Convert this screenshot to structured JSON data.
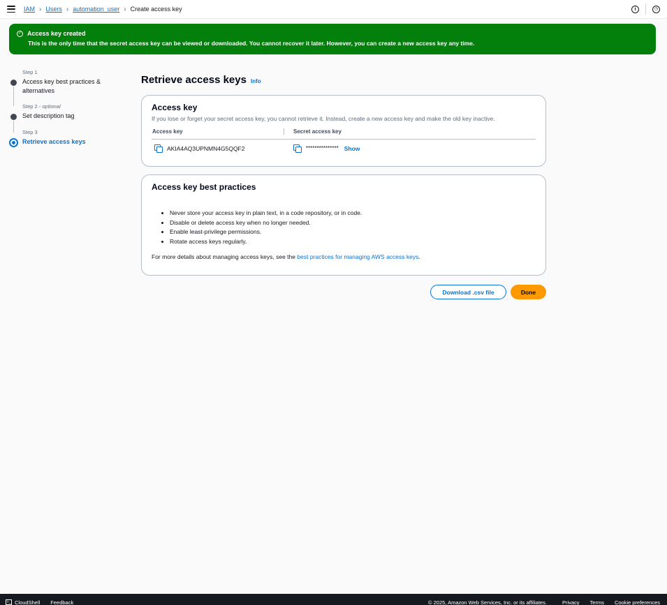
{
  "breadcrumb": {
    "items": [
      "IAM",
      "Users",
      "automation_user"
    ],
    "current": "Create access key"
  },
  "flash": {
    "title": "Access key created",
    "message": "This is the only time that the secret access key can be viewed or downloaded. You cannot recover it later. However, you can create a new access key any time.",
    "color": "#037f0c"
  },
  "steps": [
    {
      "num": "Step 1",
      "optional": "",
      "label": "Access key best practices & alternatives"
    },
    {
      "num": "Step 2",
      "optional": "optional",
      "label": "Set description tag"
    },
    {
      "num": "Step 3",
      "optional": "",
      "label": "Retrieve access keys"
    }
  ],
  "page": {
    "title": "Retrieve access keys",
    "info": "Info"
  },
  "access_key_card": {
    "title": "Access key",
    "description": "If you lose or forget your secret access key, you cannot retrieve it. Instead, create a new access key and make the old key inactive.",
    "col_access_key": "Access key",
    "col_secret_key": "Secret access key",
    "access_key_value": "AKIA4AQ3UPNMN4G5QQF2",
    "secret_masked": "***************",
    "show_label": "Show"
  },
  "best_practices": {
    "title": "Access key best practices",
    "items": [
      "Never store your access key in plain text, in a code repository, or in code.",
      "Disable or delete access key when no longer needed.",
      "Enable least-privilege permissions.",
      "Rotate access keys regularly."
    ],
    "more_prefix": "For more details about managing access keys, see the ",
    "more_link": "best practices for managing AWS access keys",
    "more_suffix": "."
  },
  "actions": {
    "download": "Download .csv file",
    "done": "Done"
  },
  "footer": {
    "cloudshell": "CloudShell",
    "feedback": "Feedback",
    "copyright": "© 2025, Amazon Web Services, Inc. or its affiliates.",
    "privacy": "Privacy",
    "terms": "Terms",
    "cookies": "Cookie preferences"
  },
  "colors": {
    "accent": "#0972d3",
    "primary_button": "#ff9900",
    "footer_bg": "#16191f"
  }
}
